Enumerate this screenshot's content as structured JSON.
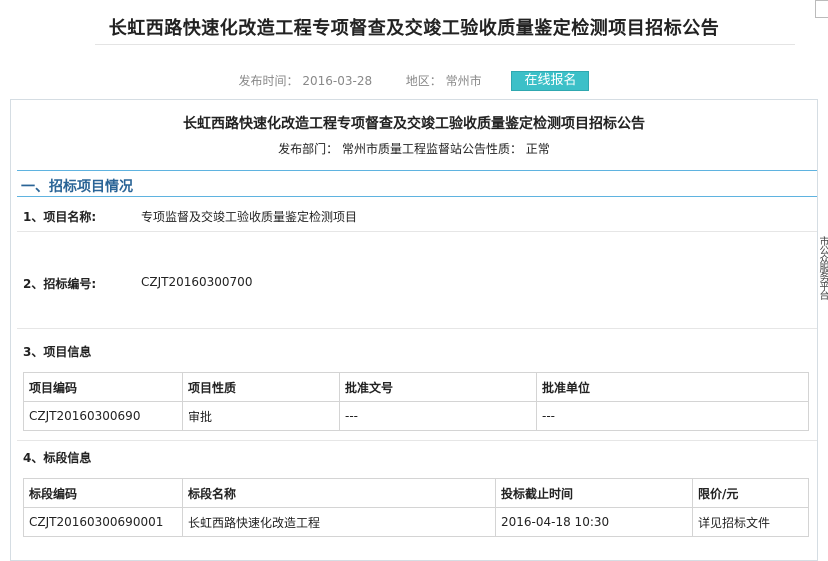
{
  "page": {
    "title": "长虹西路快速化改造工程专项督查及交竣工验收质量鉴定检测项目招标公告",
    "publish_time_label": "发布时间：",
    "publish_time": "2016-03-28",
    "region_label": "地区：",
    "region": "常州市",
    "register_button": "在线报名"
  },
  "doc": {
    "title": "长虹西路快速化改造工程专项督查及交竣工验收质量鉴定检测项目招标公告",
    "dept_line": "发布部门：  常州市质量工程监督站公告性质：  正常"
  },
  "section1": {
    "heading": "一、招标项目情况",
    "item1_label": "1、项目名称:",
    "item1_value": "专项监督及交竣工验收质量鉴定检测项目",
    "item2_label": "2、招标编号:",
    "item2_value": "CZJT20160300700",
    "item3_label": "3、项目信息",
    "project_table": {
      "headers": [
        "项目编码",
        "项目性质",
        "批准文号",
        "批准单位"
      ],
      "rows": [
        [
          "CZJT20160300690",
          "审批",
          "---",
          "---"
        ]
      ]
    },
    "item4_label": "4、标段信息",
    "section_table": {
      "headers": [
        "标段编码",
        "标段名称",
        "投标截止时间",
        "限价/元"
      ],
      "rows": [
        [
          "CZJT20160300690001",
          "长虹西路快速化改造工程",
          "2016-04-18 10:30",
          "详见招标文件"
        ]
      ]
    }
  },
  "side_note": "市公众服务平台"
}
